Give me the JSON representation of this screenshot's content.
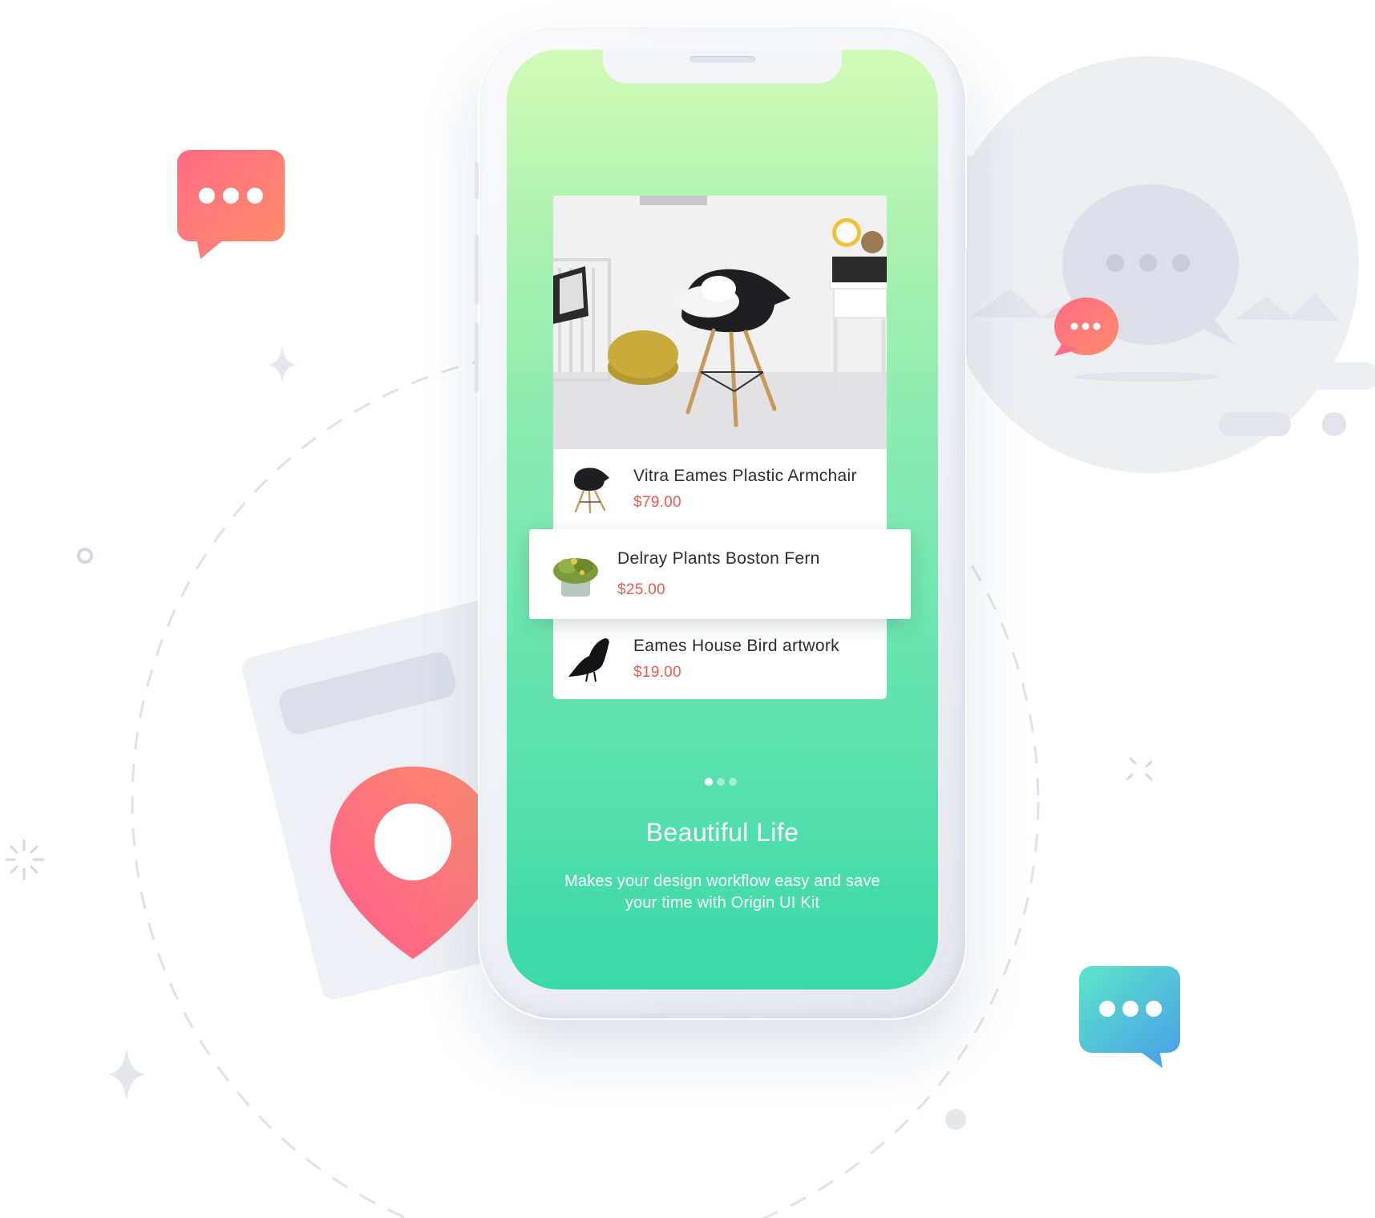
{
  "products": [
    {
      "name": "Vitra Eames Plastic Armchair",
      "price": "$79.00",
      "thumb": "chair-icon"
    },
    {
      "name": "Delray Plants Boston Fern",
      "price": "$25.00",
      "thumb": "plant-icon"
    },
    {
      "name": "Eames House Bird artwork",
      "price": "$19.00",
      "thumb": "bird-icon"
    }
  ],
  "onboarding": {
    "title": "Beautiful Life",
    "description": "Makes your design workflow easy and save your time with Origin UI Kit",
    "pages": 3,
    "active_page": 1
  },
  "colors": {
    "screen_gradient_top": "#d3fab8",
    "screen_gradient_bottom": "#3ad9a8",
    "price": "#ee5a4f",
    "pin_gradient": [
      "#ff6f8a",
      "#ff8a6a"
    ],
    "chat_blue_gradient": [
      "#5de3c9",
      "#4aa6e6"
    ]
  }
}
